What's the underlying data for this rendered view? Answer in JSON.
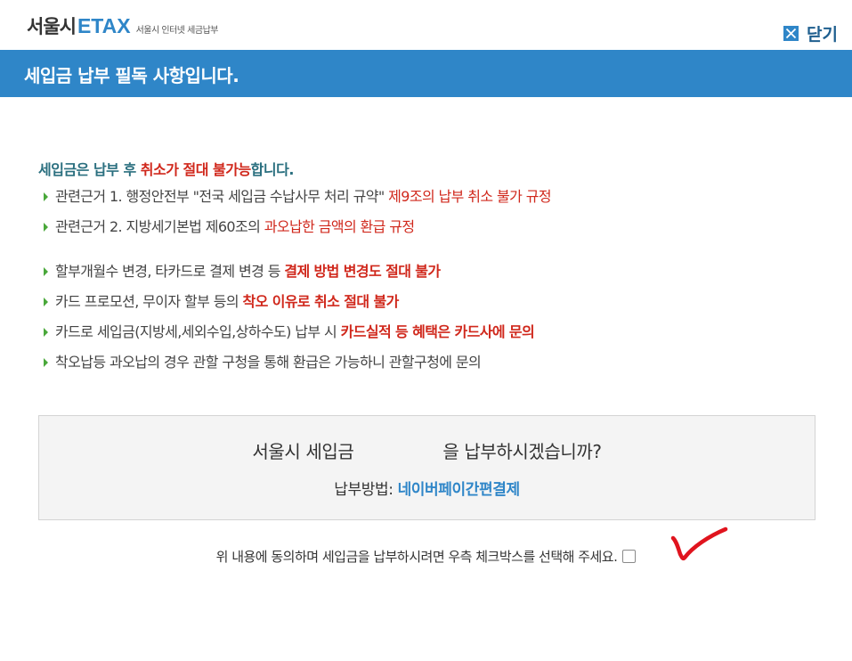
{
  "logo": {
    "seoul": "서울시",
    "etax": "ETAX",
    "sub": "서울시 인터넷 세금납부"
  },
  "close": {
    "label": "닫기"
  },
  "header": {
    "title": "세입금 납부 필독 사항입니다."
  },
  "notice": {
    "title_normal": "세입금은 납부 후 ",
    "title_highlight": "취소가 절대 불가능",
    "title_tail": "합니다.",
    "items": [
      {
        "normal": "관련근거 1. 행정안전부 \"전국 세입금 수납사무 처리 규약\" ",
        "highlight": "제9조의 납부 취소 불가 규정"
      },
      {
        "normal": "관련근거 2. 지방세기본법 제60조의 ",
        "highlight": "과오납한 금액의 환급 규정"
      }
    ],
    "items2": [
      {
        "normal": "할부개월수 변경, 타카드로 결제 변경 등 ",
        "highlight": "결제 방법 변경도 절대 불가"
      },
      {
        "normal": "카드 프로모션, 무이자 할부 등의 ",
        "highlight": "착오 이유로 취소 절대 불가"
      },
      {
        "normal": "카드로 세입금(지방세,세외수입,상하수도) 납부 시 ",
        "highlight": "카드실적 등 혜택은 카드사에 문의"
      },
      {
        "normal": "착오납등 과오납의 경우 관할 구청을 통해 환급은 가능하니 관할구청에 문의",
        "highlight": ""
      }
    ]
  },
  "confirm": {
    "prefix": "서울시 세입금",
    "suffix": "을 납부하시겠습니까?",
    "method_label": "납부방법: ",
    "method_value": "네이버페이간편결제"
  },
  "agree": {
    "text": "위 내용에 동의하며 세입금을 납부하시려면 우측 체크박스를 선택해 주세요."
  },
  "colors": {
    "brand_blue": "#2f86c8",
    "highlight_red": "#d0281c",
    "arrow_green": "#49a83a",
    "check_red": "#e0141e"
  }
}
